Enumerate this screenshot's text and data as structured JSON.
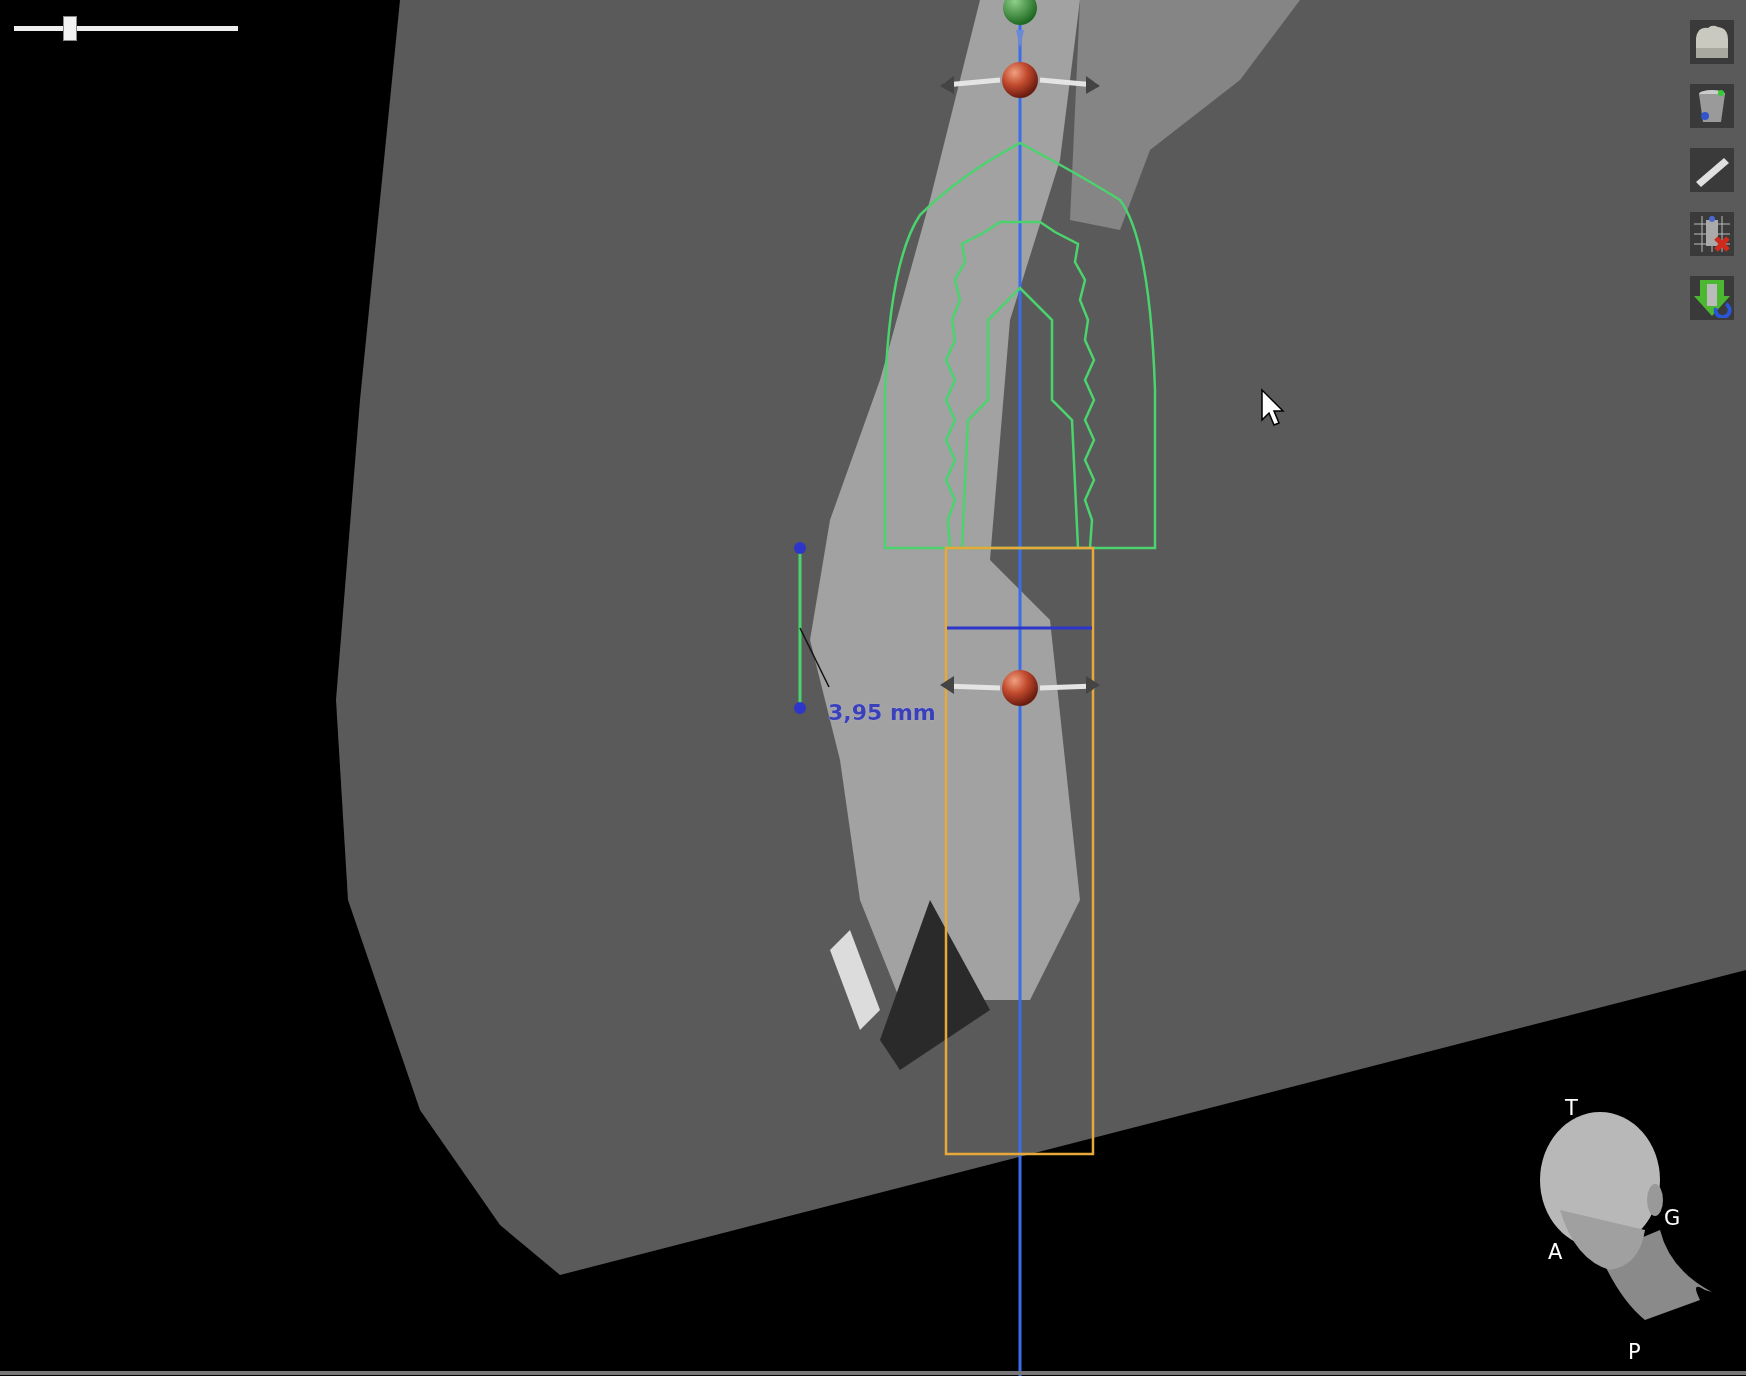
{
  "zoom_slider": {
    "level": 0.25
  },
  "measurement": {
    "label": "3,95 mm"
  },
  "orientation_labels": [
    {
      "kind": "top",
      "text": "T"
    },
    {
      "kind": "right",
      "text": "G"
    },
    {
      "kind": "front",
      "text": "A"
    },
    {
      "kind": "bottom",
      "text": "P"
    }
  ]
}
